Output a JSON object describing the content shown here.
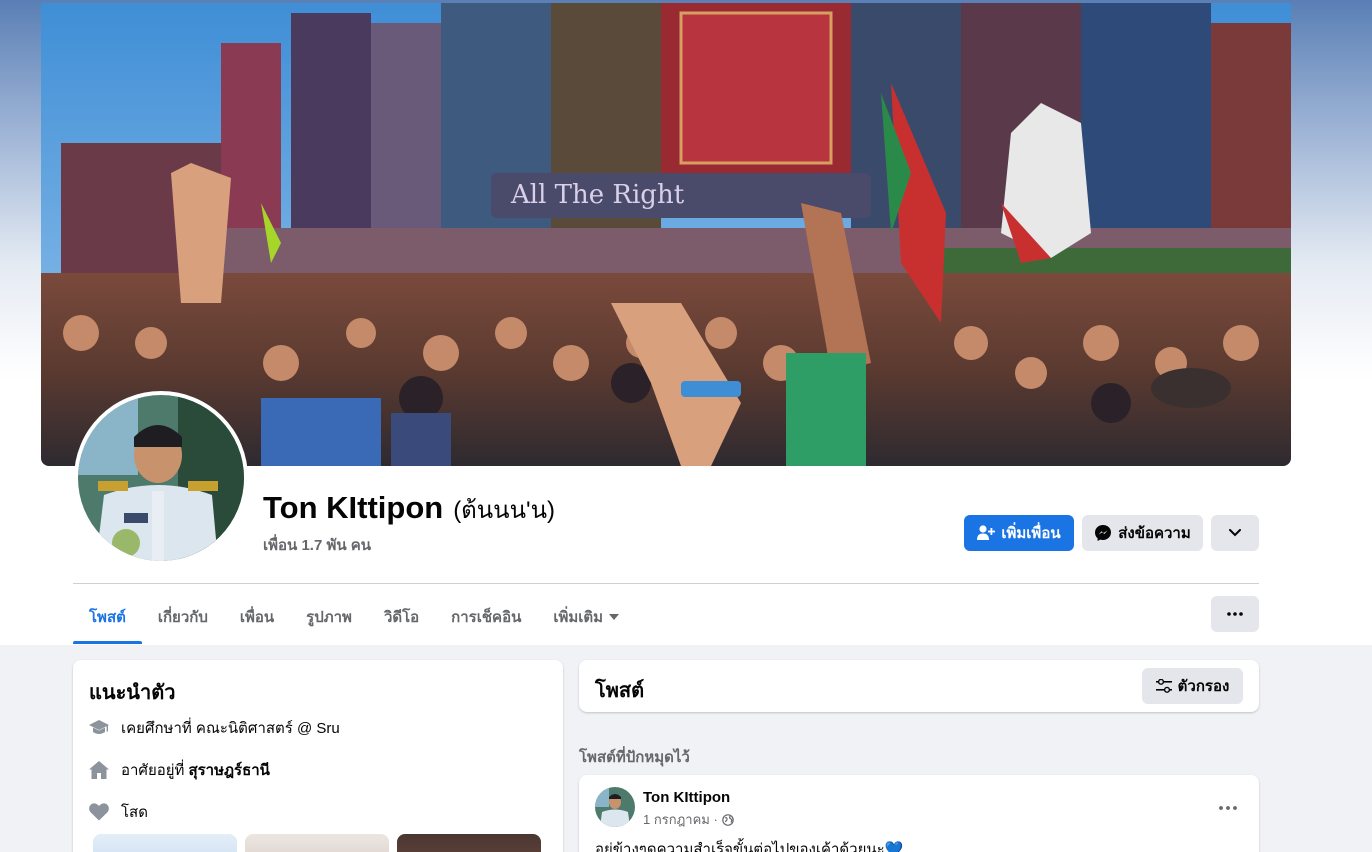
{
  "profile": {
    "name": "Ton KIttipon",
    "alt_name": "(ต้นนน'น)",
    "friends": "เพื่อน 1.7 พัน คน"
  },
  "actions": {
    "add_friend": "เพิ่มเพื่อน",
    "message": "ส่งข้อความ"
  },
  "tabs": [
    {
      "label": "โพสต์",
      "active": true
    },
    {
      "label": "เกี่ยวกับ"
    },
    {
      "label": "เพื่อน"
    },
    {
      "label": "รูปภาพ"
    },
    {
      "label": "วิดีโอ"
    },
    {
      "label": "การเช็คอิน"
    },
    {
      "label": "เพิ่มเติม"
    }
  ],
  "intro": {
    "title": "แนะนำตัว",
    "education": "เคยศึกษาที่ คณะนิติศาสตร์ @ Sru",
    "lives_prefix": "อาศัยอยู่ที่",
    "lives_place": "สุราษฎร์ธานี",
    "relationship": "โสด"
  },
  "posts": {
    "title": "โพสต์",
    "filter_label": "ตัวกรอง",
    "pinned_label": "โพสต์ที่ปักหมุดไว้"
  },
  "pinned_post": {
    "author": "Ton KIttipon",
    "date": "1 กรกฎาคม ·",
    "text": "อยู่ข้างๆดูความสำเร็จขั้นต่อไปของเค้าด้วยนะ💙"
  },
  "icons": {
    "education": "graduation-cap-icon",
    "home": "home-icon",
    "relationship": "heart-icon",
    "messenger": "messenger-icon",
    "add_friend": "add-friend-icon",
    "privacy": "globe-icon"
  },
  "colors": {
    "accent": "#1b74e4",
    "secondary_button": "#e4e6eb",
    "page_bg": "#f0f2f5",
    "muted_text": "#65676b"
  }
}
